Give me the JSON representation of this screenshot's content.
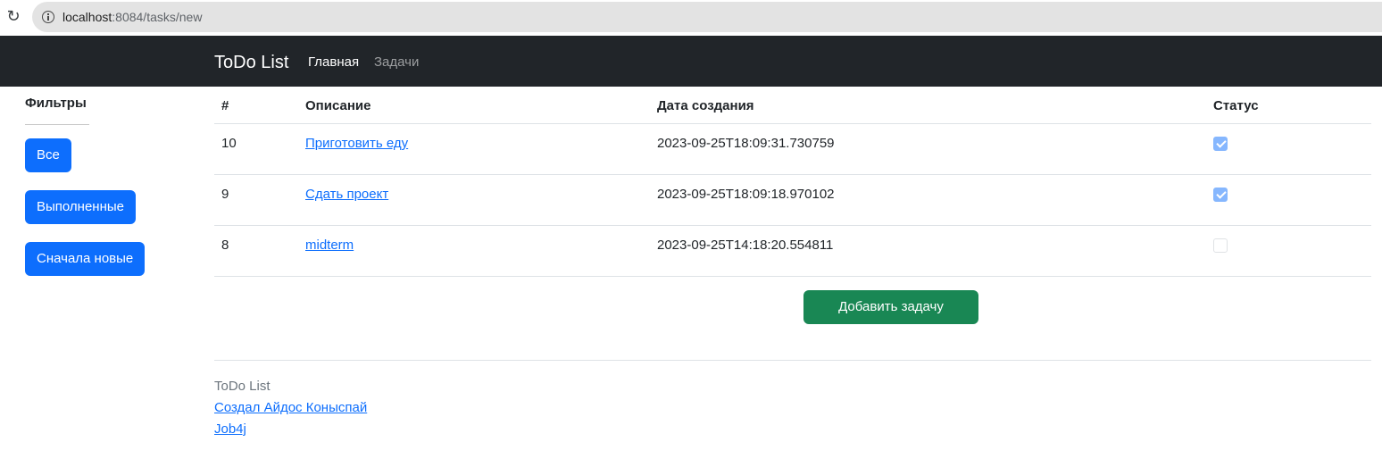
{
  "browser": {
    "url_host": "localhost",
    "url_rest": ":8084/tasks/new",
    "reload_icon": "reload-icon",
    "info_icon": "info-icon"
  },
  "navbar": {
    "brand": "ToDo List",
    "links": [
      {
        "label": "Главная",
        "active": true
      },
      {
        "label": "Задачи",
        "active": false
      }
    ]
  },
  "sidebar": {
    "title": "Фильтры",
    "buttons": [
      {
        "label": "Все"
      },
      {
        "label": "Выполненные"
      },
      {
        "label": "Сначала новые"
      }
    ]
  },
  "table": {
    "headers": [
      "#",
      "Описание",
      "Дата создания",
      "Статус"
    ],
    "rows": [
      {
        "id": "10",
        "description": "Приготовить еду",
        "created": "2023-09-25T18:09:31.730759",
        "done": true
      },
      {
        "id": "9",
        "description": "Сдать проект",
        "created": "2023-09-25T18:09:18.970102",
        "done": true
      },
      {
        "id": "8",
        "description": "midterm",
        "created": "2023-09-25T14:18:20.554811",
        "done": false
      }
    ]
  },
  "add_button": {
    "label": "Добавить задачу"
  },
  "footer": {
    "title": "ToDo List",
    "author_link": "Создал Айдос Коныспай",
    "job4j_link": "Job4j"
  },
  "colors": {
    "navbar_bg": "#212529",
    "primary": "#0d6efd",
    "success": "#198754",
    "checkbox_checked": "#86b7fe"
  }
}
